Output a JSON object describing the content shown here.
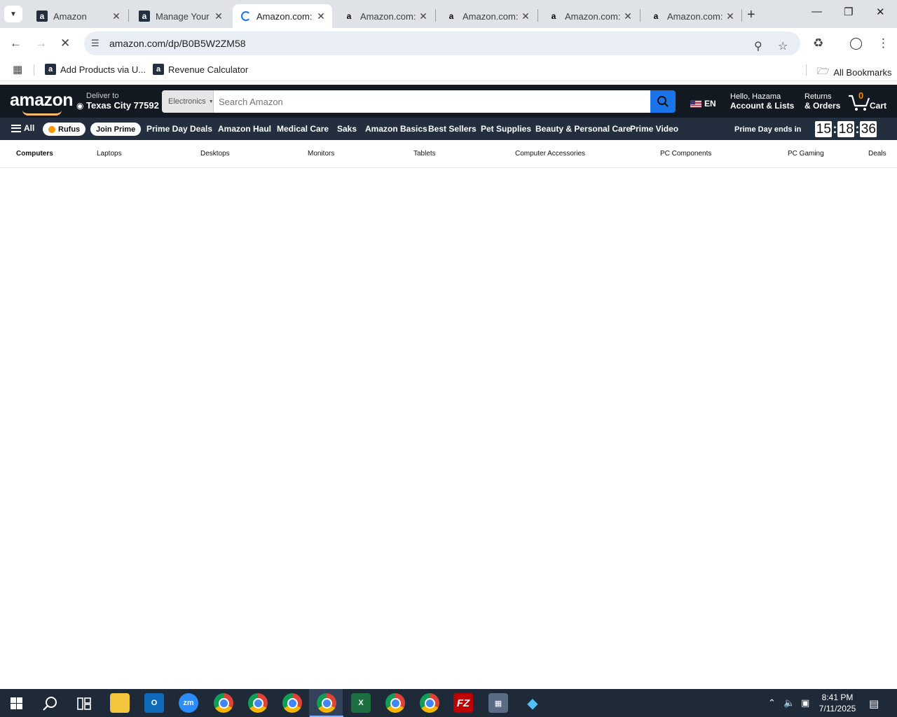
{
  "browser": {
    "tabs": [
      {
        "title": "Amazon",
        "favicon": "amazon-a-dark"
      },
      {
        "title": "Manage Your",
        "favicon": "amazon-a-dark"
      },
      {
        "title": "Amazon.com:",
        "favicon": "loading-spinner",
        "active": true
      },
      {
        "title": "Amazon.com:",
        "favicon": "amazon-a-light"
      },
      {
        "title": "Amazon.com:",
        "favicon": "amazon-a-light"
      },
      {
        "title": "Amazon.com:",
        "favicon": "amazon-a-light"
      },
      {
        "title": "Amazon.com:",
        "favicon": "amazon-a-light"
      }
    ],
    "url": "amazon.com/dp/B0B5W2ZM58",
    "bookmarks": [
      {
        "label": "Add Products via U..."
      },
      {
        "label": "Revenue Calculator"
      }
    ],
    "all_bookmarks": "All Bookmarks"
  },
  "amazon": {
    "logo": "amazon",
    "deliver": {
      "line1": "Deliver to",
      "line2": "Texas City 77592"
    },
    "search": {
      "category": "Electronics",
      "placeholder": "Search Amazon"
    },
    "language": "EN",
    "account": {
      "line1": "Hello, Hazama",
      "line2": "Account & Lists"
    },
    "returns": {
      "line1": "Returns",
      "line2": "& Orders"
    },
    "cart": {
      "count": "0",
      "label": "Cart"
    },
    "nav": {
      "all": "All",
      "rufus": "Rufus",
      "join_prime": "Join Prime",
      "items": [
        "Prime Day Deals",
        "Amazon Haul",
        "Medical Care",
        "Saks",
        "Amazon Basics",
        "Best Sellers",
        "Pet Supplies",
        "Beauty & Personal Care",
        "Prime Video"
      ],
      "countdown": {
        "label": "Prime Day ends in",
        "hours": "15",
        "minutes": "18",
        "seconds": "36"
      }
    },
    "subnav": [
      "Computers",
      "Laptops",
      "Desktops",
      "Monitors",
      "Tablets",
      "Computer Accessories",
      "PC Components",
      "PC Gaming",
      "Deals"
    ]
  },
  "taskbar": {
    "apps": [
      "start",
      "search",
      "task-view",
      "file-explorer",
      "outlook",
      "zoom",
      "chrome",
      "chrome",
      "chrome",
      "chrome",
      "excel",
      "chrome",
      "chrome",
      "filezilla",
      "calculator",
      "app"
    ],
    "time": "8:41 PM",
    "date": "7/11/2025"
  },
  "colors": {
    "amazon_dark": "#131921",
    "amazon_nav": "#232f3e",
    "search_button": "#1a73e8",
    "cart_count": "#f08804"
  }
}
